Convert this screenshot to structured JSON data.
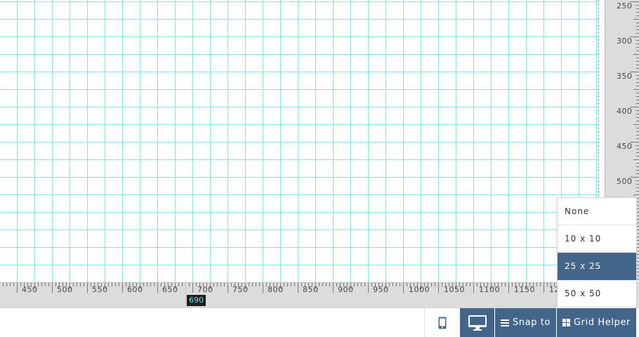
{
  "ruler_right": {
    "labels": [
      "250",
      "300",
      "350",
      "400",
      "450",
      "500"
    ]
  },
  "ruler_bottom": {
    "labels": [
      "450",
      "500",
      "550",
      "600",
      "650",
      "700",
      "750",
      "800",
      "850",
      "900",
      "950",
      "1000",
      "1050",
      "1100",
      "1150",
      "12"
    ]
  },
  "cursor": {
    "value": "690"
  },
  "grid_menu": {
    "options": [
      "None",
      "10 x 10",
      "25 x 25",
      "50 x 50"
    ],
    "selected": "25 x 25"
  },
  "toolbar": {
    "mobile_icon": "mobile-phone-icon",
    "desktop_icon": "desktop-monitor-icon",
    "snap_label": "Snap to",
    "snap_icon": "list-lines-icon",
    "grid_label": "Grid Helper",
    "grid_icon": "grid-squares-icon"
  },
  "colors": {
    "accent": "#44658a",
    "grid_line": "#7fe6e6",
    "ruler_bg": "#dcdcdc"
  }
}
